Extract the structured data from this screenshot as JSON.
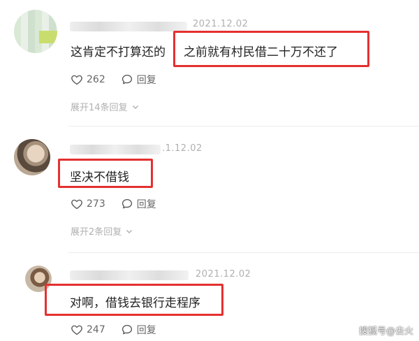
{
  "comments": [
    {
      "timestamp": "2021.12.02",
      "text_plain": "这肯定不打算还的",
      "text_highlighted": "之前就有村民借二十万不还了",
      "likes": "262",
      "reply_label": "回复",
      "expand_label": "展开14条回复"
    },
    {
      "timestamp": ".1.12.02",
      "text_plain": "",
      "text_highlighted": "坚决不借钱",
      "likes": "273",
      "reply_label": "回复",
      "expand_label": "展开2条回复"
    },
    {
      "timestamp": "2021.12.02",
      "text_plain": "",
      "text_highlighted": "对啊，借钱去银行走程序",
      "likes": "247",
      "reply_label": "回复",
      "expand_label": ""
    }
  ],
  "watermark": "搜狐号@去火",
  "colors": {
    "highlight_box": "#e53030",
    "muted_text": "#b0b0b0"
  }
}
